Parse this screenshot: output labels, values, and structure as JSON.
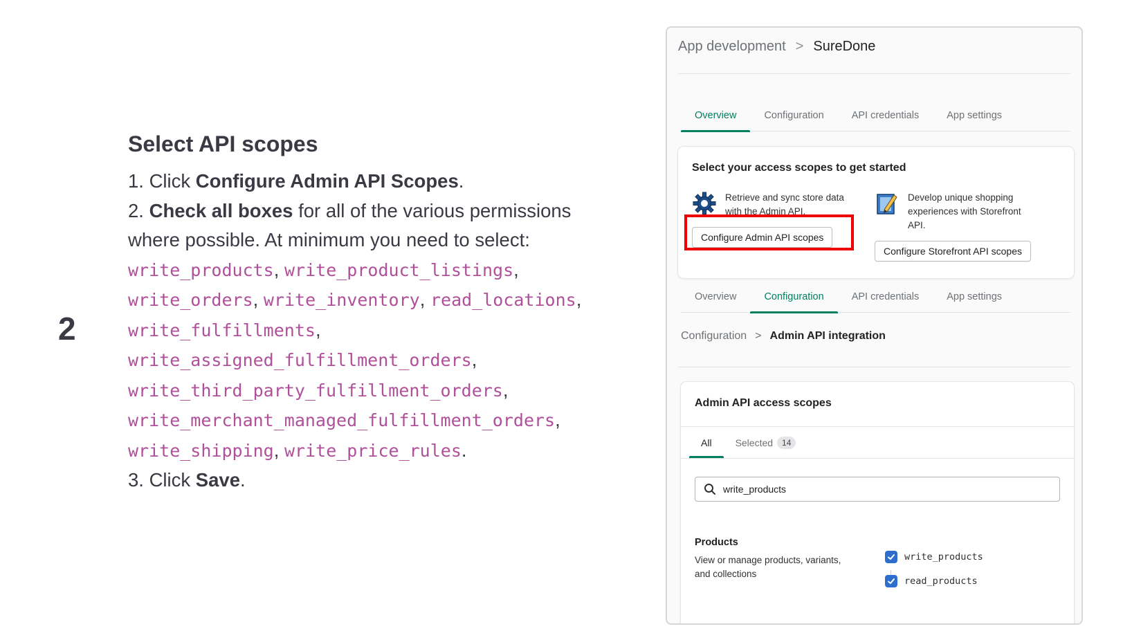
{
  "step": {
    "number": "2"
  },
  "instructions": {
    "heading": "Select API scopes",
    "item1": {
      "prefix": "1. Click ",
      "bold": "Configure Admin API Scopes",
      "suffix": "."
    },
    "item2": {
      "prefix": "2. ",
      "bold": "Check all boxes",
      "text1": " for all of the various permissions",
      "text2": "where possible. At minimum you need to select:"
    },
    "scopes": [
      "write_products",
      "write_product_listings",
      "write_orders",
      "write_inventory",
      "read_locations",
      "write_fulfillments",
      "write_assigned_fulfillment_orders",
      "write_third_party_fulfillment_orders",
      "write_merchant_managed_fulfillment_orders",
      "write_shipping",
      "write_price_rules"
    ],
    "item3": {
      "prefix": "3. Click ",
      "bold": "Save",
      "suffix": "."
    },
    "comma": ",",
    "period": "."
  },
  "screenshot": {
    "breadcrumb": {
      "parent": "App development",
      "separator": ">",
      "current": "SureDone"
    },
    "tabs_top": [
      "Overview",
      "Configuration",
      "API credentials",
      "App settings"
    ],
    "tabs_top_active": "Overview",
    "access_card": {
      "title": "Select your access scopes to get started",
      "admin_feature": {
        "icon": "gear-icon",
        "text_line1": "Retrieve and sync store data",
        "text_line2": "with the Admin API."
      },
      "admin_button": "Configure Admin API scopes",
      "storefront_feature": {
        "icon": "storefront-icon",
        "text_line1": "Develop unique shopping",
        "text_line2": "experiences with Storefront",
        "text_line3": "API."
      },
      "storefront_button": "Configure Storefront API scopes",
      "highlight_color": "#ee0000"
    },
    "tabs_bottom": [
      "Overview",
      "Configuration",
      "API credentials",
      "App settings"
    ],
    "tabs_bottom_active": "Configuration",
    "sub_breadcrumb": {
      "parent": "Configuration",
      "separator": ">",
      "current": "Admin API integration"
    },
    "admin_scopes_card": {
      "title": "Admin API access scopes",
      "tab_all": "All",
      "tab_selected": "Selected",
      "selected_count": "14",
      "search_value": "write_products",
      "section_title": "Products",
      "section_desc_line1": "View or manage products, variants,",
      "section_desc_line2": "and collections",
      "permissions": [
        {
          "label": "write_products",
          "checked": true
        },
        {
          "label": "read_products",
          "checked": true
        }
      ]
    },
    "colors": {
      "accent": "#008060",
      "checkbox": "#2c6ecb",
      "code": "#b0509a"
    }
  }
}
